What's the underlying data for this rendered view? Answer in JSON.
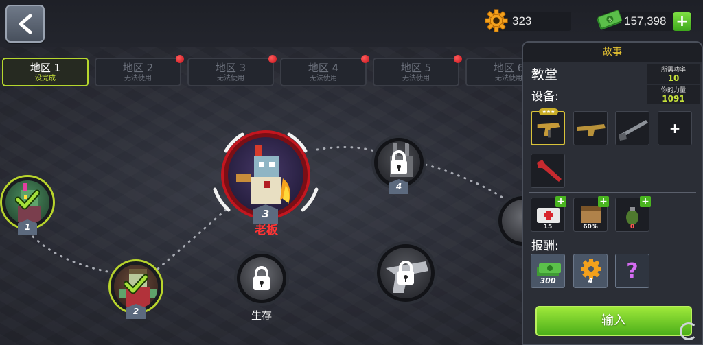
{
  "topbar": {
    "back_icon": "chevron-left-icon",
    "gears_value": "323",
    "cash_value": "157,398",
    "plus_label": "+"
  },
  "tabs": [
    {
      "title": "地区 1",
      "status": "没完成",
      "active": true
    },
    {
      "title": "地区 2",
      "status": "无法使用",
      "active": false
    },
    {
      "title": "地区 3",
      "status": "无法使用",
      "active": false
    },
    {
      "title": "地区 4",
      "status": "无法使用",
      "active": false
    },
    {
      "title": "地区 5",
      "status": "无法使用",
      "active": false
    },
    {
      "title": "地区 6",
      "status": "无法使用",
      "active": false
    }
  ],
  "map": {
    "nodes": [
      {
        "number": "1",
        "state": "completed"
      },
      {
        "number": "2",
        "state": "completed"
      },
      {
        "number": "3",
        "state": "boss",
        "label": "老板"
      },
      {
        "number": "4",
        "state": "locked"
      },
      {
        "number": "",
        "state": "locked",
        "label": "生存"
      },
      {
        "number": "",
        "state": "locked"
      }
    ]
  },
  "panel": {
    "header": "故事",
    "location": "教堂",
    "required_power_label": "所需功率",
    "required_power_value": "10",
    "your_power_label": "你的力量",
    "your_power_value": "1091",
    "equipment_label": "设备:",
    "add_slot_label": "+",
    "stars": "★★★",
    "consumables": [
      {
        "name": "medkit",
        "count": "15"
      },
      {
        "name": "ammo-crate",
        "count": "60%"
      },
      {
        "name": "grenade",
        "count": "0"
      }
    ],
    "rewards_label": "报酬:",
    "rewards": [
      {
        "name": "cash",
        "count": "300"
      },
      {
        "name": "gear",
        "count": "4"
      },
      {
        "name": "mystery",
        "count": "?"
      }
    ],
    "enter_label": "输入"
  },
  "colors": {
    "accent_green": "#b6d72d",
    "gold": "#e8c532",
    "button_green": "#4caf1a",
    "alert_red": "#c4111a"
  }
}
